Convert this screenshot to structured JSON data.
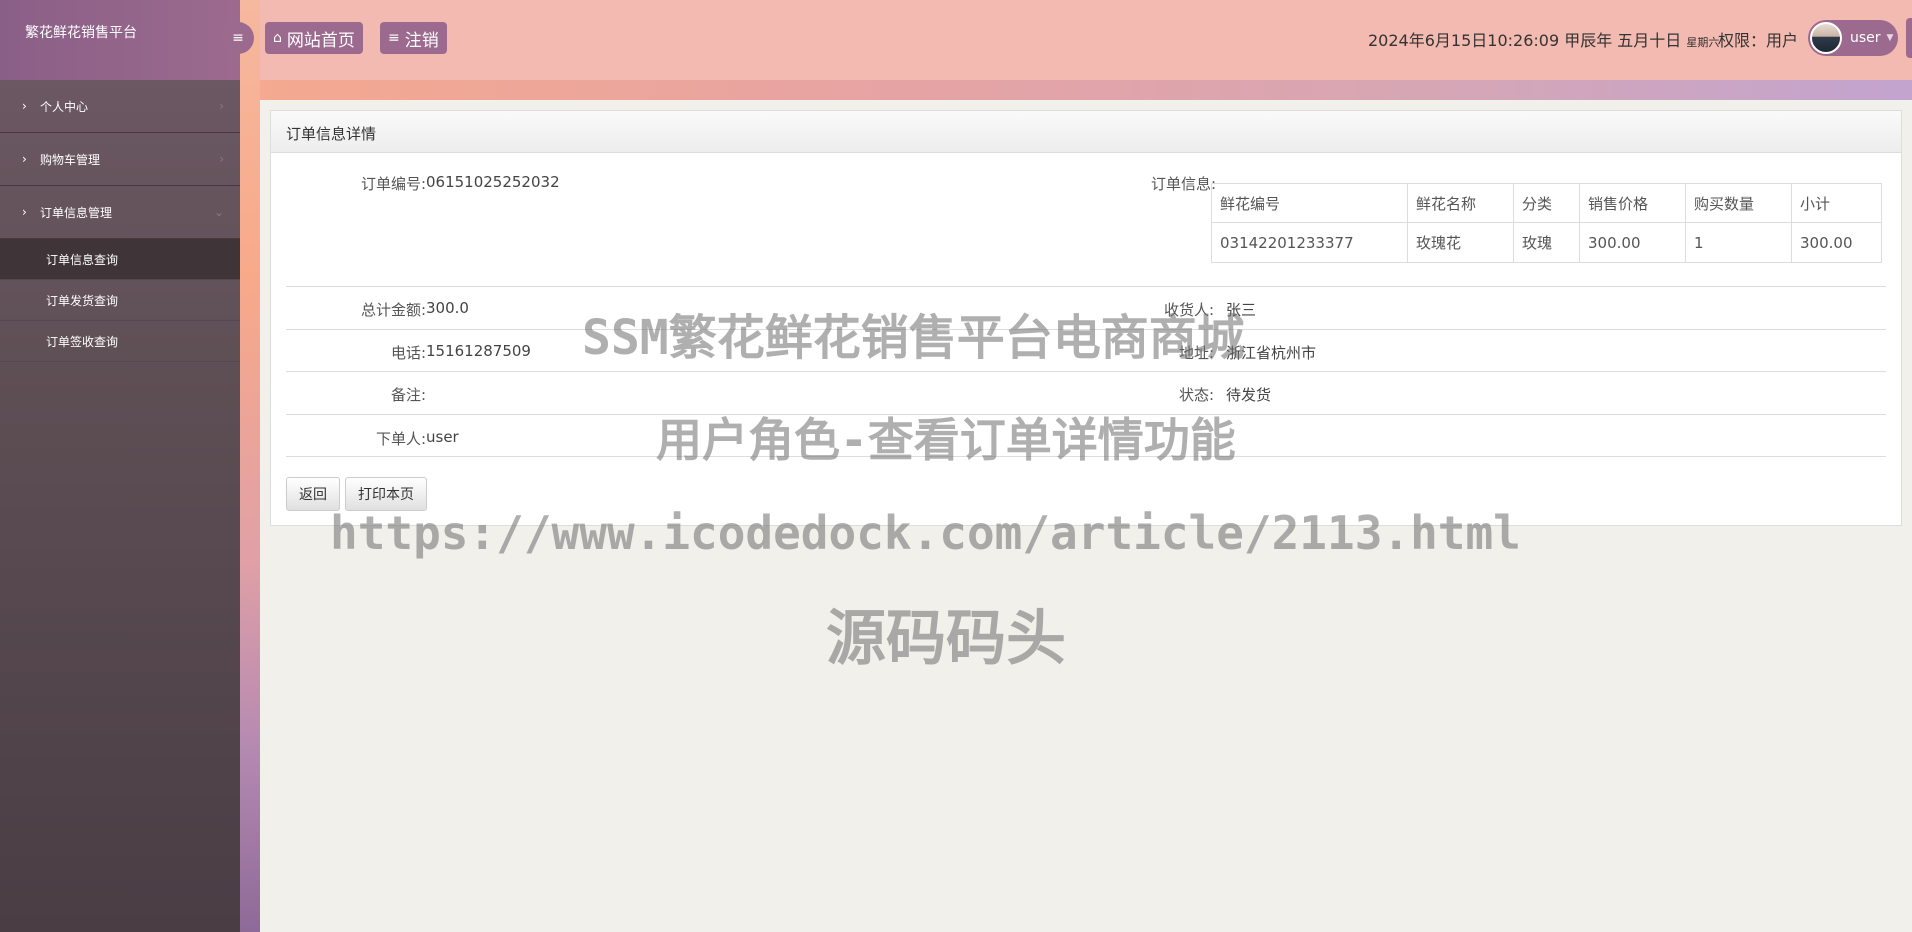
{
  "app": {
    "brand": "繁花鲜花销售平台"
  },
  "sidebar": {
    "items": [
      {
        "label": "个人中心"
      },
      {
        "label": "购物车管理"
      },
      {
        "label": "订单信息管理"
      }
    ],
    "subitems": [
      {
        "label": "订单信息查询"
      },
      {
        "label": "订单发货查询"
      },
      {
        "label": "订单签收查询"
      }
    ]
  },
  "header": {
    "home_label": "网站首页",
    "logout_label": "注销",
    "datetime": "2024年6月15日10:26:09 甲辰年 五月十日",
    "weekday": "星期六",
    "permission": "权限：用户",
    "username": "user"
  },
  "panel": {
    "title": "订单信息详情",
    "order_no_label": "订单编号:",
    "order_no": "06151025252032",
    "order_info_label": "订单信息:",
    "table": {
      "headers": [
        "鲜花编号",
        "鲜花名称",
        "分类",
        "销售价格",
        "购买数量",
        "小计"
      ],
      "rows": [
        [
          "03142201233377",
          "玫瑰花",
          "玫瑰",
          "300.00",
          "1",
          "300.00"
        ]
      ]
    },
    "total_label": "总计金额:",
    "total": "300.0",
    "receiver_label": "收货人:",
    "receiver": "张三",
    "phone_label": "电话:",
    "phone": "15161287509",
    "address_label": "地址:",
    "address": "浙江省杭州市",
    "remark_label": "备注:",
    "remark": "",
    "status_label": "状态:",
    "status": "待发货",
    "orderer_label": "下单人:",
    "orderer": "user",
    "back_label": "返回",
    "print_label": "打印本页"
  },
  "watermark": {
    "line1": "SSM繁花鲜花销售平台电商商城",
    "line2": "用户角色-查看订单详情功能",
    "line3": "https://www.icodedock.com/article/2113.html",
    "line4": "源码码头"
  },
  "colors": {
    "accent": "#9c6a8e",
    "header_bg": "#f2bab1"
  }
}
